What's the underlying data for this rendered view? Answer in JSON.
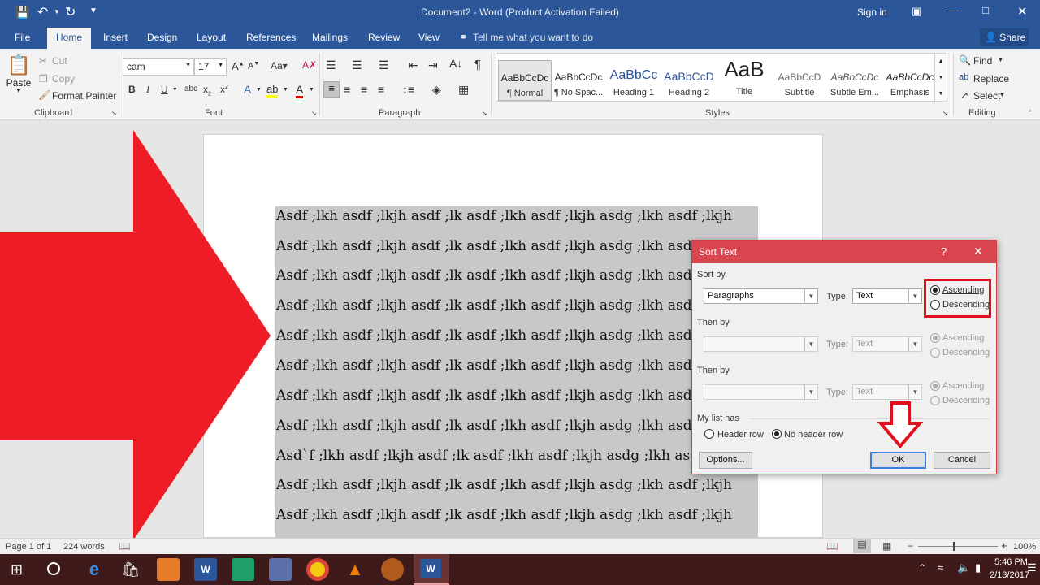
{
  "window": {
    "title": "Document2 - Word (Product Activation Failed)",
    "sign_in": "Sign in",
    "share": "Share",
    "tell_me": "Tell me what you want to do"
  },
  "tabs": [
    "File",
    "Home",
    "Insert",
    "Design",
    "Layout",
    "References",
    "Mailings",
    "Review",
    "View"
  ],
  "ribbon": {
    "clipboard": {
      "paste": "Paste",
      "cut": "Cut",
      "copy": "Copy",
      "format_painter": "Format Painter",
      "label": "Clipboard"
    },
    "font": {
      "name": "cam",
      "size": "17",
      "label": "Font"
    },
    "paragraph": {
      "label": "Paragraph"
    },
    "styles": {
      "label": "Styles",
      "items": [
        {
          "preview": "AaBbCcDc",
          "name": "¶ Normal"
        },
        {
          "preview": "AaBbCcDc",
          "name": "¶ No Spac..."
        },
        {
          "preview": "AaBbCc",
          "name": "Heading 1"
        },
        {
          "preview": "AaBbCcD",
          "name": "Heading 2"
        },
        {
          "preview": "AaB",
          "name": "Title"
        },
        {
          "preview": "AaBbCcD",
          "name": "Subtitle"
        },
        {
          "preview": "AaBbCcDc",
          "name": "Subtle Em..."
        },
        {
          "preview": "AaBbCcDc",
          "name": "Emphasis"
        }
      ]
    },
    "editing": {
      "find": "Find",
      "replace": "Replace",
      "select": "Select",
      "label": "Editing"
    }
  },
  "document": {
    "lines": [
      "Asdf ;lkh asdf ;lkjh asdf ;lk asdf ;lkh asdf ;lkjh asdg ;lkh asdf ;lkjh",
      "Asdf ;lkh asdf ;lkjh asdf ;lk asdf ;lkh asdf ;lkjh asdg ;lkh asdf ;lkjh",
      "Asdf ;lkh asdf ;lkjh asdf ;lk asdf ;lkh asdf ;lkjh asdg ;lkh asdf ;lkjh",
      "Asdf ;lkh asdf ;lkjh asdf ;lk asdf ;lkh asdf ;lkjh asdg ;lkh asdf ;lkjh",
      "Asdf ;lkh asdf ;lkjh asdf ;lk asdf ;lkh asdf ;lkjh asdg ;lkh asdf ;lkjh",
      "Asdf ;lkh asdf ;lkjh asdf ;lk asdf ;lkh asdf ;lkjh asdg ;lkh asdf ;lkjh",
      "Asdf ;lkh asdf ;lkjh asdf ;lk asdf ;lkh asdf ;lkjh asdg ;lkh asdf ;lkjh",
      "Asdf ;lkh asdf ;lkjh asdf ;lk asdf ;lkh asdf ;lkjh asdg ;lkh asdf ;lkjh",
      "Asd`f ;lkh asdf ;lkjh asdf ;lk asdf ;lkh asdf ;lkjh asdg ;lkh asdf ;lkjh",
      "Asdf ;lkh asdf ;lkjh asdf ;lk asdf ;lkh asdf ;lkjh asdg ;lkh asdf ;lkjh",
      "Asdf ;lkh asdf ;lkjh asdf ;lk asdf ;lkh asdf ;lkjh asdg ;lkh asdf ;lkjh"
    ]
  },
  "dialog": {
    "title": "Sort Text",
    "help": "?",
    "close": "✕",
    "sort_by": "Sort by",
    "sort_by_value": "Paragraphs",
    "type_label": "Type:",
    "type_value": "Text",
    "ascending": "Ascending",
    "descending": "Descending",
    "then_by": "Then by",
    "my_list_has": "My list has",
    "header_row": "Header row",
    "no_header_row": "No header row",
    "options": "Options...",
    "ok": "OK",
    "cancel": "Cancel"
  },
  "status": {
    "page": "Page 1 of 1",
    "words": "224 words",
    "zoom": "100%"
  },
  "taskbar": {
    "time": "5:46 PM",
    "date": "2/13/2017"
  },
  "colors": {
    "word_blue": "#2b579a",
    "dialog_title": "#d9454f",
    "arrow_red": "#ee1c25",
    "highlight_box": "#e0101c",
    "taskbar": "#3e1a1a"
  }
}
